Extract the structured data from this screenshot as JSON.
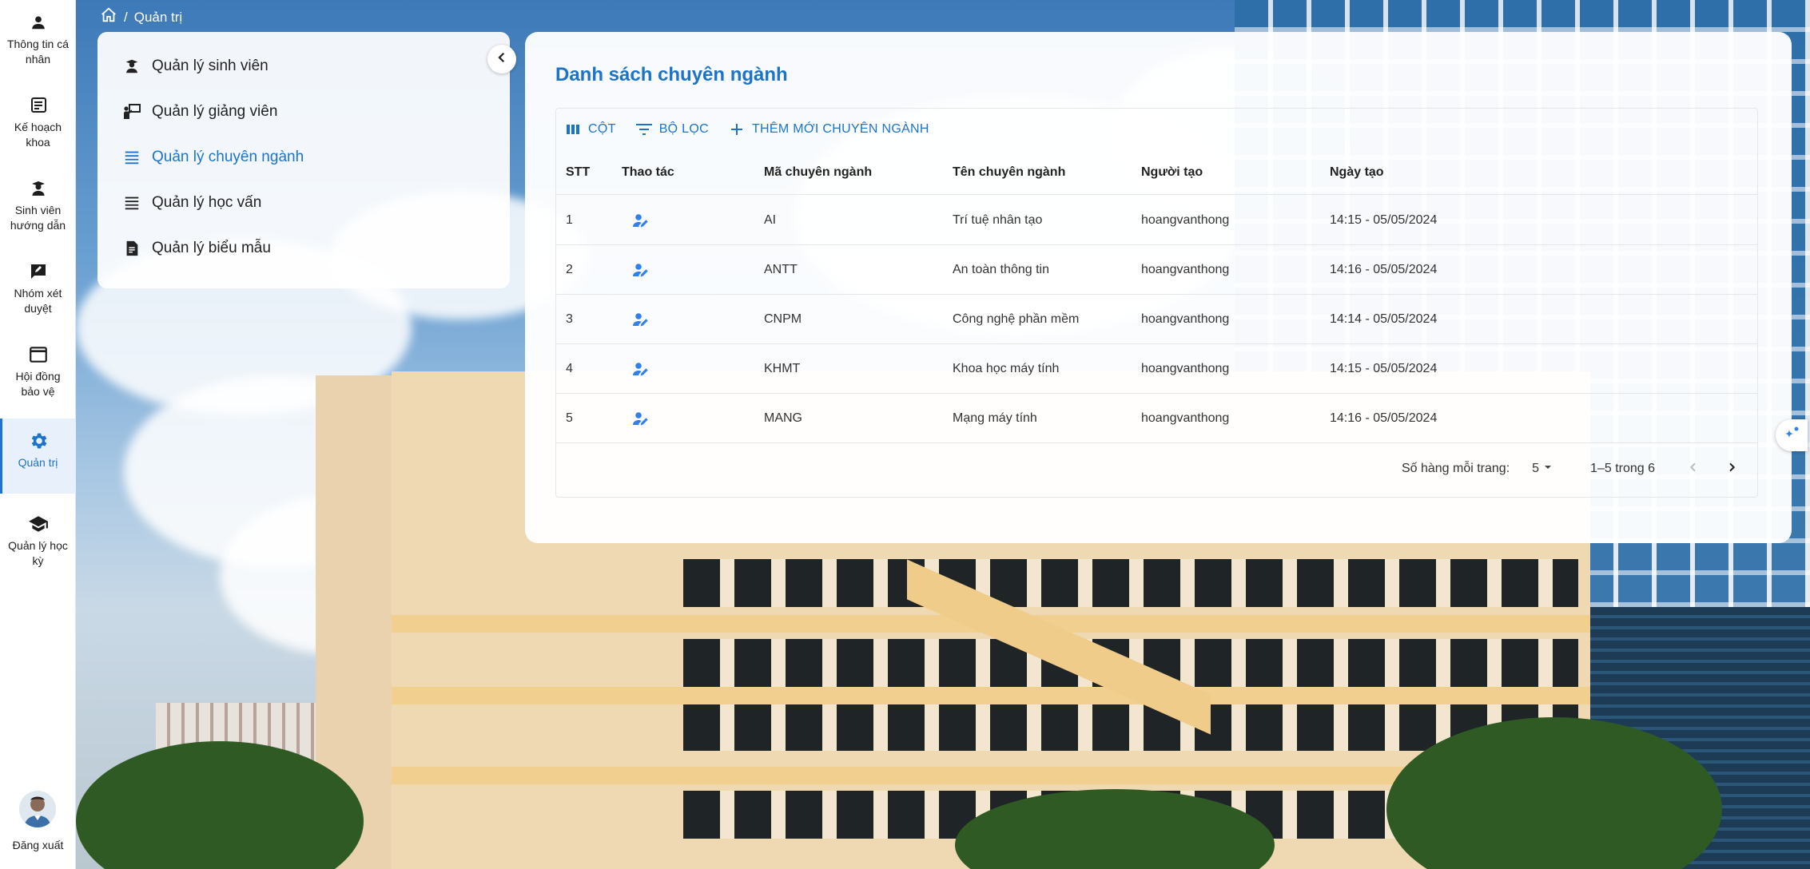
{
  "nav": {
    "items": [
      {
        "label": "Thông tin cá nhân",
        "icon": "person-icon"
      },
      {
        "label": "Kế hoạch khoa",
        "icon": "newspaper-icon"
      },
      {
        "label": "Sinh viên hướng dẫn",
        "icon": "student-icon"
      },
      {
        "label": "Nhóm xét duyệt",
        "icon": "rate-review-icon"
      },
      {
        "label": "Hội đồng bảo vệ",
        "icon": "window-icon"
      },
      {
        "label": "Quản trị",
        "icon": "gear-icon",
        "active": true
      },
      {
        "label": "Quản lý học kỳ",
        "icon": "school-icon"
      }
    ],
    "logout_label": "Đăng xuất"
  },
  "breadcrumb": {
    "current": "Quản trị"
  },
  "submenu": {
    "items": [
      {
        "label": "Quản lý sinh viên",
        "icon": "student-icon"
      },
      {
        "label": "Quản lý giảng viên",
        "icon": "teacher-icon"
      },
      {
        "label": "Quản lý chuyên ngành",
        "icon": "list-icon",
        "active": true
      },
      {
        "label": "Quản lý học vấn",
        "icon": "list-icon"
      },
      {
        "label": "Quản lý biểu mẫu",
        "icon": "document-icon"
      }
    ]
  },
  "main": {
    "title": "Danh sách chuyên ngành",
    "toolbar": {
      "columns_label": "CỘT",
      "filter_label": "BỘ LỌC",
      "add_label": "THÊM MỚI CHUYÊN NGÀNH"
    },
    "columns": [
      "STT",
      "Thao tác",
      "Mã chuyên ngành",
      "Tên chuyên ngành",
      "Người tạo",
      "Ngày tạo"
    ],
    "rows": [
      {
        "stt": "1",
        "ma": "AI",
        "ten": "Trí tuệ nhân tạo",
        "nguoi_tao": "hoangvanthong",
        "ngay_tao": "14:15 - 05/05/2024"
      },
      {
        "stt": "2",
        "ma": "ANTT",
        "ten": "An toàn thông tin",
        "nguoi_tao": "hoangvanthong",
        "ngay_tao": "14:16 - 05/05/2024"
      },
      {
        "stt": "3",
        "ma": "CNPM",
        "ten": "Công nghệ phần mềm",
        "nguoi_tao": "hoangvanthong",
        "ngay_tao": "14:14 - 05/05/2024"
      },
      {
        "stt": "4",
        "ma": "KHMT",
        "ten": "Khoa học máy tính",
        "nguoi_tao": "hoangvanthong",
        "ngay_tao": "14:15 - 05/05/2024"
      },
      {
        "stt": "5",
        "ma": "MANG",
        "ten": "Mạng máy tính",
        "nguoi_tao": "hoangvanthong",
        "ngay_tao": "14:16 - 05/05/2024"
      }
    ],
    "pagination": {
      "rows_per_page_label": "Số hàng mỗi trang:",
      "rows_per_page_value": "5",
      "range_label": "1–5 trong 6"
    }
  },
  "colors": {
    "accent": "#1b74c9",
    "edit_icon": "#2f80ed"
  }
}
